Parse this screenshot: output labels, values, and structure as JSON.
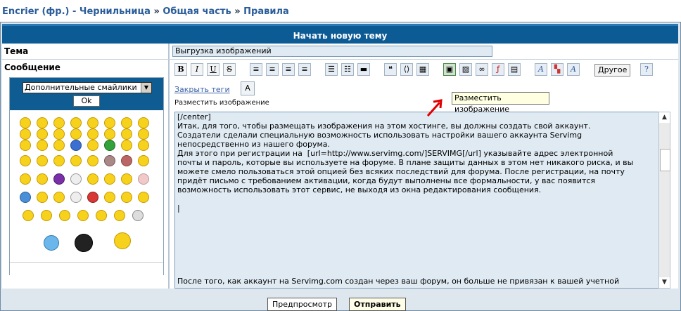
{
  "breadcrumb": {
    "item1": "Encrier (фр.) - Чернильница",
    "sep": "»",
    "item2": "Общая часть",
    "item3": "Правила"
  },
  "form": {
    "header_title": "Начать новую тему",
    "subject_label": "Тема",
    "subject_value": "Выгрузка изображений",
    "message_label": "Сообщение"
  },
  "smilies": {
    "dropdown_value": "Дополнительные смайлики",
    "ok_label": "Ok"
  },
  "toolbar": {
    "bold": "B",
    "italic": "I",
    "underline": "U",
    "strike": "S",
    "more_label": "Другое",
    "close_tags": "Закрыть теги",
    "help_text": "Разместить изображение",
    "tooltip": "Разместить изображение"
  },
  "message_lines": [
    "[/center]",
    "Итак, для того, чтобы размещать изображения на этом хостинге, вы должны создать свой аккаунт.",
    "Создатели сделали специальную возможность использовать настройки вашего аккаунта Servimg",
    "непосредственно из нашего форума.",
    "Для этого при регистрации на  [url=http://www.servimg.com/]SERVIMG[/url] указывайте адрес электронной",
    "почты и пароль, которые вы используете на форуме. В плане защиты данных в этом нет никакого риска, и вы",
    "можете смело пользоваться этой опцией без всяких последствий для форума. После регистрации, на почту",
    "придёт письмо с требованием активации, когда будут выполнены все формальности, у вас появится",
    "возможность использовать этот сервис, не выходя из окна редактирования сообщения.",
    "",
    "|",
    "",
    "",
    "",
    "",
    "",
    "",
    "",
    "После того, как аккаунт на Servimg.com создан через ваш форум, он больше не привязан к вашей учетной"
  ],
  "buttons": {
    "preview": "Предпросмотр",
    "submit": "Отправить"
  },
  "colors": {
    "header_bg": "#0c5b94",
    "link": "#2a5d99",
    "field_bg": "#dfeaf2"
  }
}
